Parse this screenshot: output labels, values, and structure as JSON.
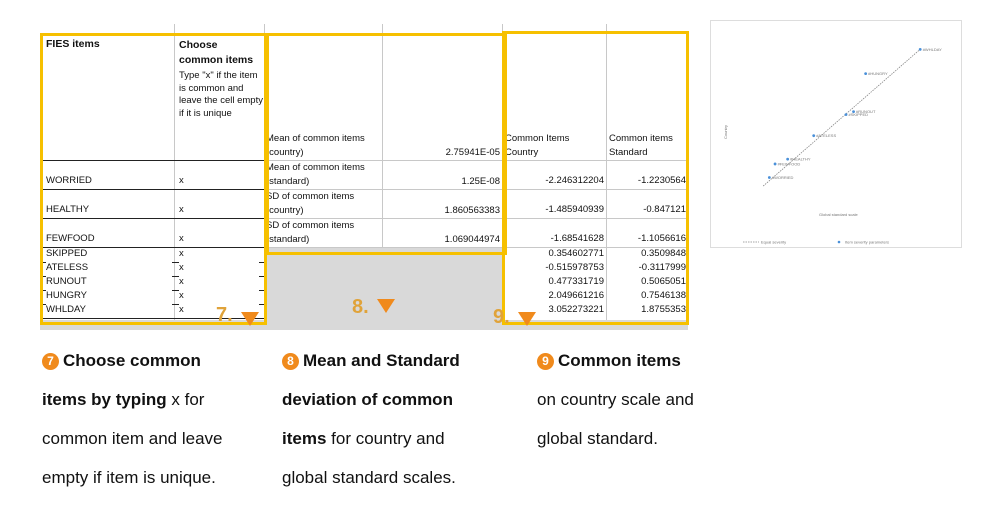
{
  "sheet": {
    "col_header_items": "FIES items",
    "col_header_choose_bold": "Choose common items",
    "col_header_choose_note": "Type \"x\" if the item is common and leave the cell empty if it is unique",
    "rows": [
      {
        "item": "WORRIED",
        "mark": "x",
        "country": "-2.246312204",
        "standard": "-1.2230564"
      },
      {
        "item": "HEALTHY",
        "mark": "x",
        "country": "-1.485940939",
        "standard": "-0.847121"
      },
      {
        "item": "FEWFOOD",
        "mark": "x",
        "country": "-1.68541628",
        "standard": "-1.1056616"
      },
      {
        "item": "SKIPPED",
        "mark": "x",
        "country": "0.354602771",
        "standard": "0.3509848"
      },
      {
        "item": "ATELESS",
        "mark": "x",
        "country": "-0.515978753",
        "standard": "-0.3117999"
      },
      {
        "item": "RUNOUT",
        "mark": "x",
        "country": "0.477331719",
        "standard": "0.5065051"
      },
      {
        "item": "HUNGRY",
        "mark": "x",
        "country": "2.049661216",
        "standard": "0.7546138"
      },
      {
        "item": "WHLDAY",
        "mark": "x",
        "country": "3.052273221",
        "standard": "1.8755353"
      }
    ],
    "stats": [
      {
        "label_line1": "Mean of common items",
        "label_line2": "(country)",
        "value": "2.75941E-05"
      },
      {
        "label_line1": "Mean of common items",
        "label_line2": "(standard)",
        "value": "1.25E-08"
      },
      {
        "label_line1": "SD of common items",
        "label_line2": "(country)",
        "value": "1.860563383"
      },
      {
        "label_line1": "SD of common items",
        "label_line2": "(standard)",
        "value": "1.069044974"
      }
    ],
    "common_country_header": "Common Items Country",
    "common_standard_header": "Common items Standard"
  },
  "callouts": {
    "seven": "7.",
    "eight": "8.",
    "nine": "9."
  },
  "captions": {
    "seven": {
      "num": "7",
      "bold1": "Choose common",
      "bold2": "items by typing",
      "rest2": " x for",
      "line3": "common item and leave",
      "line4": "empty if item is unique."
    },
    "eight": {
      "num": "8",
      "bold1": "Mean and Standard",
      "bold2": "deviation of common",
      "bold3": "items",
      "rest3": " for country and",
      "line4": "global standard scales."
    },
    "nine": {
      "num": "9",
      "bold1": "Common items",
      "line2": "on country scale and",
      "line3": "global standard."
    }
  },
  "chart": {
    "ylabel": "Country",
    "xlabel": "Global standard scale",
    "legend_line": "Equal severity",
    "legend_points": "Item severity parameters",
    "colors": {
      "points": "#4a90d9",
      "line": "#888888"
    },
    "chart_data": {
      "type": "scatter",
      "series": [
        {
          "name": "Item severity parameters",
          "x": [
            -1.2230564,
            -0.847121,
            -1.1056616,
            0.3509848,
            -0.3117999,
            0.5065051,
            0.7546138,
            1.8755353
          ],
          "y": [
            -2.246312204,
            -1.485940939,
            -1.68541628,
            0.354602771,
            -0.515978753,
            0.477331719,
            2.049661216,
            3.052273221
          ]
        }
      ],
      "labels": [
        "WORRIED",
        "HEALTHY",
        "FEWFOOD",
        "SKIPPED",
        "ATELESS",
        "RUNOUT",
        "HUNGRY",
        "WHLDAY"
      ],
      "xlabel": "Global standard scale",
      "ylabel": "Country"
    }
  }
}
